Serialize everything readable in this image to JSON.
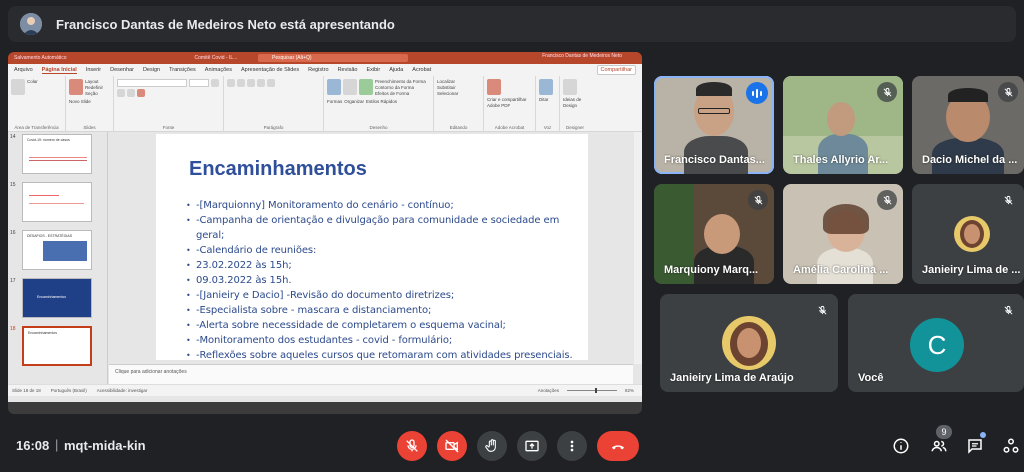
{
  "meet": {
    "presenting_banner": "Francisco Dantas de Medeiros Neto está apresentando",
    "time": "16:08",
    "separator": "|",
    "meeting_code": "mqt-mida-kin",
    "participant_count": "9"
  },
  "powerpoint": {
    "titlebar": {
      "autosave": "Salvamento Automático",
      "doc_title": "Comitê Covid - IL...",
      "search": "Pesquisar (Alt+Q)",
      "user": "Francisco Dantas de Medeiros Neto",
      "user_initials": "NJ"
    },
    "menu": [
      "Arquivo",
      "Página Inicial",
      "Inserir",
      "Desenhar",
      "Design",
      "Transições",
      "Animações",
      "Apresentação de Slides",
      "Registro",
      "Revisão",
      "Exibir",
      "Ajuda",
      "Acrobat"
    ],
    "active_menu": "Página Inicial",
    "share_button": "Compartilhar",
    "ribbon_groups": [
      "Área de Transferência",
      "Slides",
      "Fonte",
      "Parágrafo",
      "Desenho",
      "Editando",
      "Adobe Acrobat",
      "Voz",
      "Designer"
    ],
    "ribbon_labels": {
      "paste": "Colar",
      "new_slide": "Novo Slide",
      "layout": "Layout",
      "reset": "Redefinir",
      "section": "Seção",
      "shapes": "Formas",
      "arrange": "Organizar",
      "quick_styles": "Estilos Rápidos",
      "find": "Localizar",
      "replace": "Substituir",
      "select": "Selecionar",
      "acrobat": "Criar e compartilhar Adobe PDF",
      "dictate": "Ditar",
      "design_ideas": "Ideias de Design",
      "fill": "Preenchimento da Forma",
      "outline": "Contorno da Forma",
      "effects": "Efeitos de Forma"
    },
    "thumbnails": [
      {
        "num": "14",
        "text": "Covid-19: número de casos"
      },
      {
        "num": "15",
        "text": ""
      },
      {
        "num": "16",
        "text": "DESAFIOS - ESTRATÉGIAS"
      },
      {
        "num": "17",
        "text": "Encaminhamentos"
      },
      {
        "num": "18",
        "text": "Encaminhamentos"
      }
    ],
    "slide": {
      "title": "Encaminhamentos",
      "bullets": [
        "-[Marquionny] Monitoramento do cenário - contínuo;",
        "-Campanha de orientação e divulgação para comunidade e sociedade em geral;",
        "-Calendário de reuniões:",
        "23.02.2022 às 15h;",
        "09.03.2022 às 15h.",
        "-[Janieiry e Dacio]  -Revisão do documento diretrizes;",
        "-Especialista  sobre - mascara e distanciamento;",
        "-Alerta sobre necessidade de completarem o esquema vacinal;",
        "-Monitoramento dos estudantes - covid - formulário;",
        "-Reflexões sobre aqueles cursos que retomaram com atividades presenciais."
      ]
    },
    "notes_placeholder": "Clique para adicionar anotações",
    "status": {
      "slide_info": "Slide 18 de 18",
      "language": "Português (Brasil)",
      "accessibility": "Acessibilidade: investigar",
      "notes_btn": "Anotações",
      "zoom": "82%"
    }
  },
  "participants": [
    {
      "name": "Francisco Dantas...",
      "speaking": true
    },
    {
      "name": "Thales Allyrio Ar...",
      "speaking": false
    },
    {
      "name": "Dacio Michel da ...",
      "speaking": false
    },
    {
      "name": "Marquiony Marq...",
      "speaking": false
    },
    {
      "name": "Amélia Carolina ...",
      "speaking": false
    },
    {
      "name": "Janieiry Lima de ...",
      "speaking": false
    },
    {
      "name": "Janieiry Lima de Araújo",
      "speaking": false
    },
    {
      "name": "Você",
      "speaking": false,
      "initial": "C"
    }
  ],
  "colors": {
    "meet_bg": "#202124",
    "end_call": "#ea4335",
    "ppt_brand": "#b7472a",
    "slide_text": "#2c4a8c",
    "speaking_outline": "#8ab4f8",
    "you_avatar": "#12939a"
  }
}
